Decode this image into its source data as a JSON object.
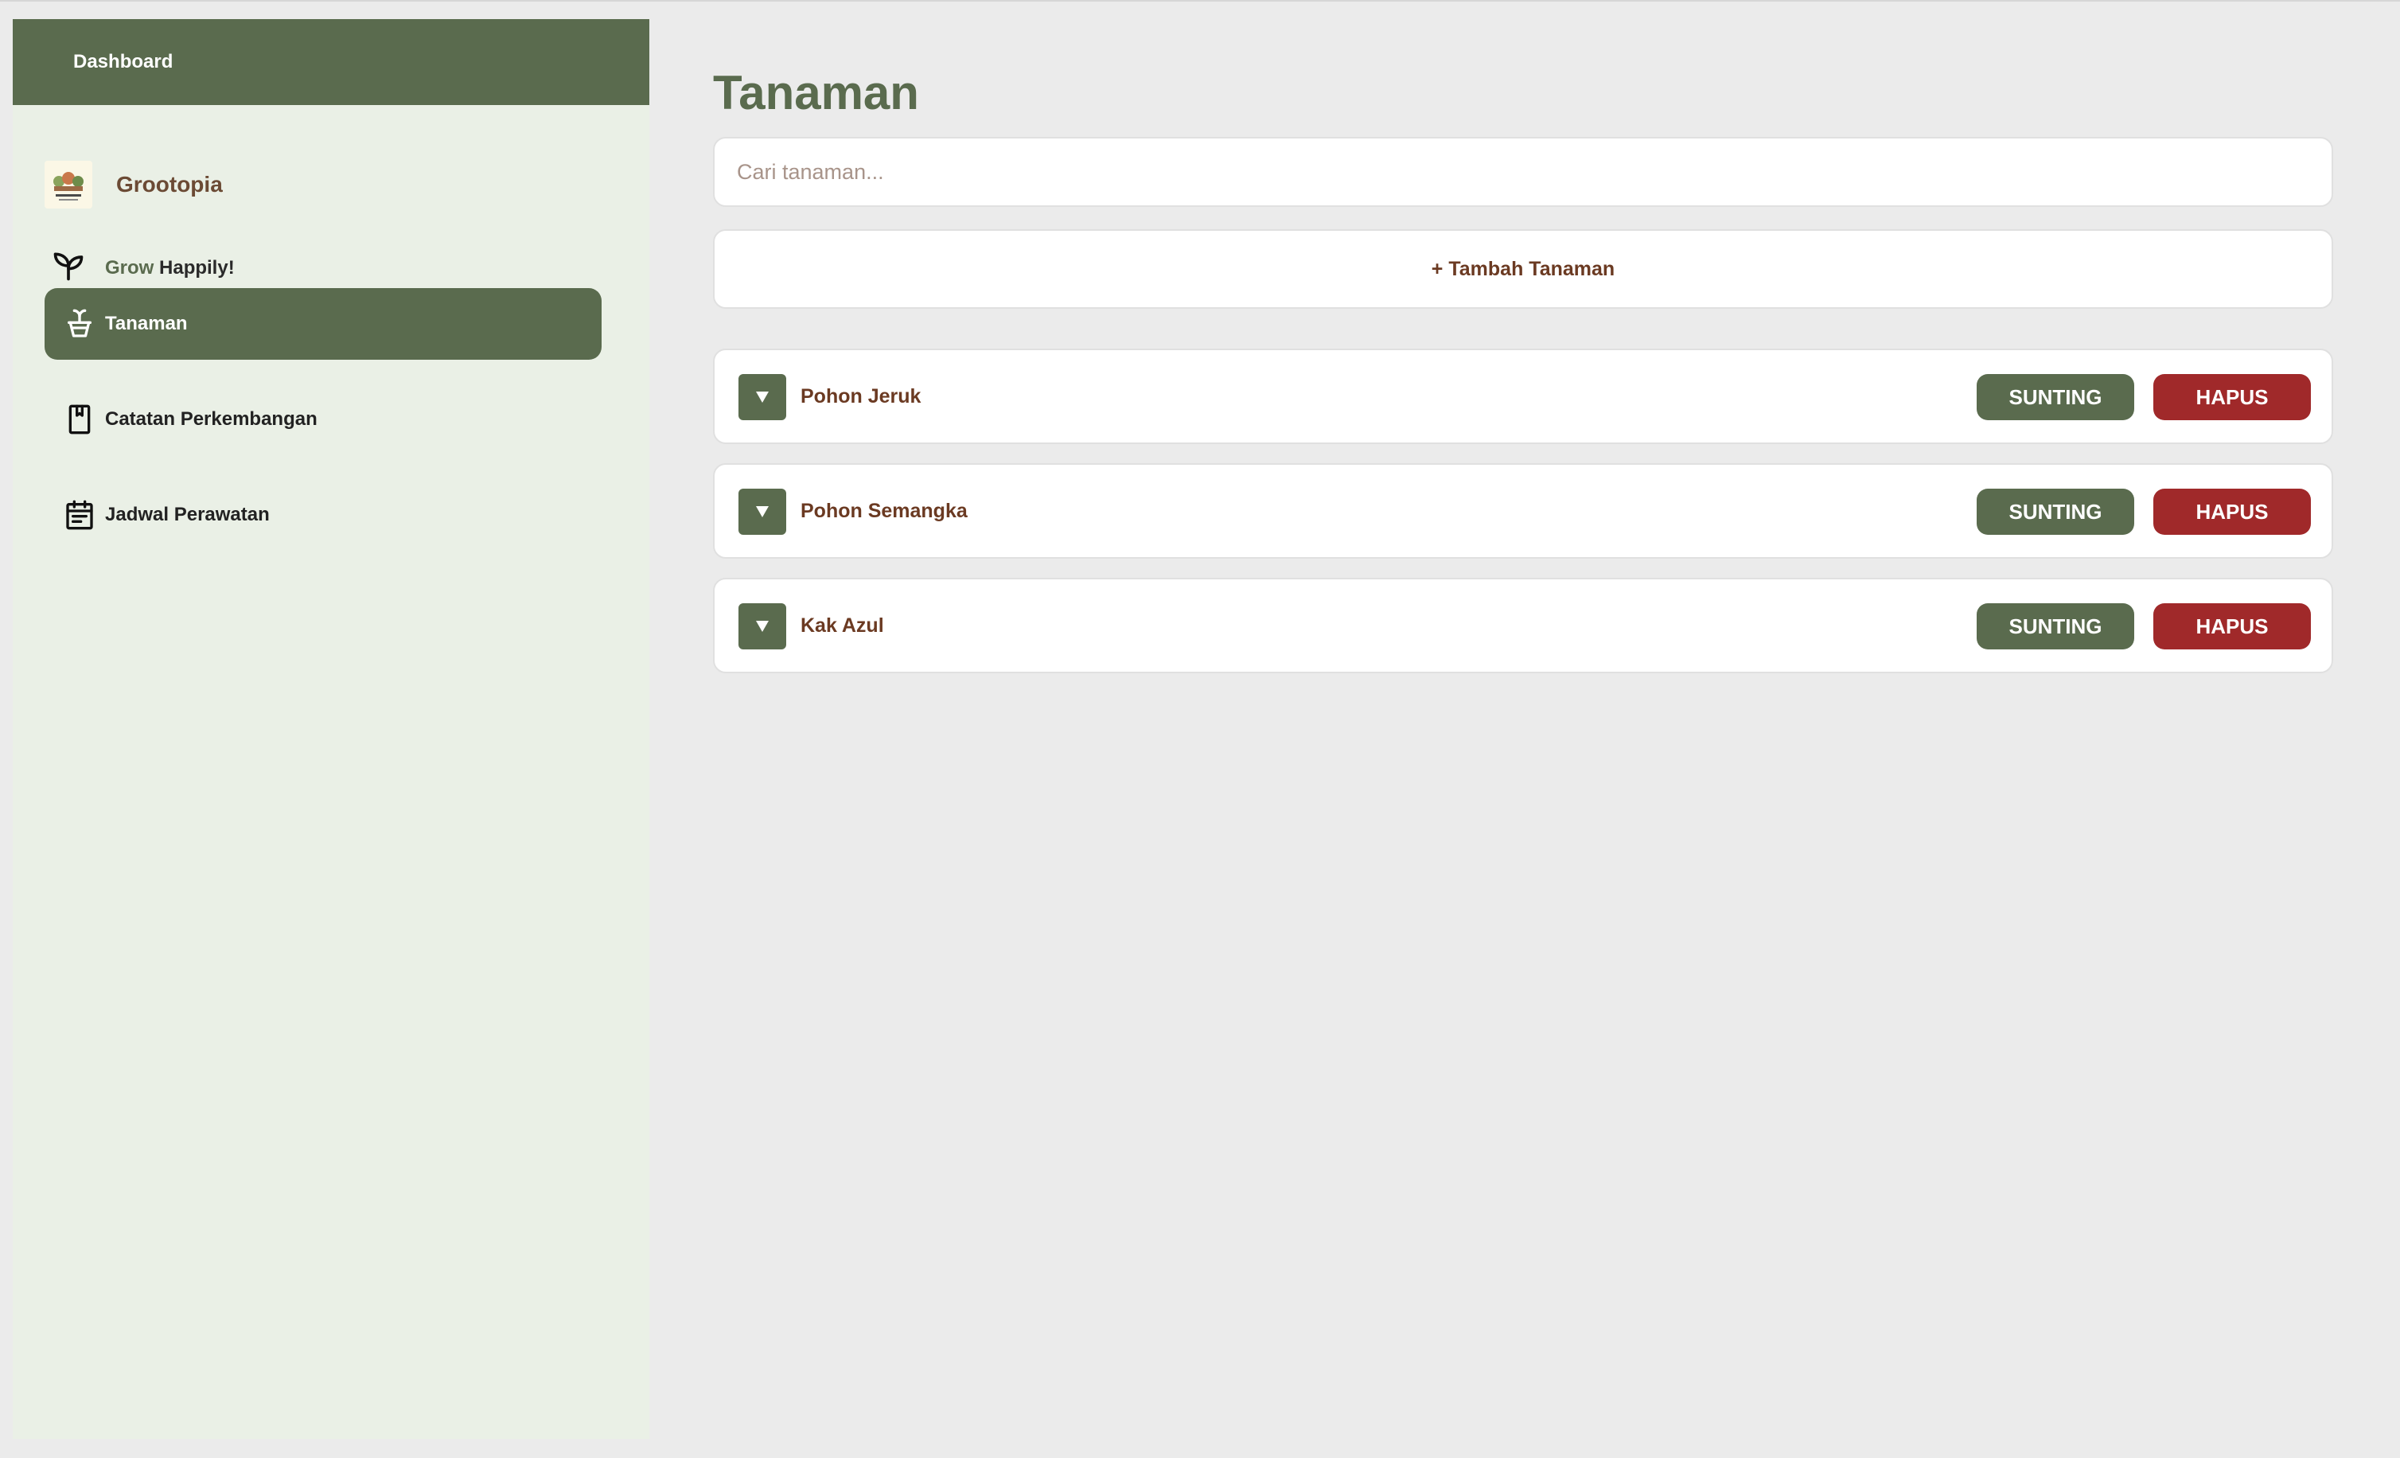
{
  "sidebar": {
    "header_label": "Dashboard",
    "brand_name": "Grootopia",
    "tagline_grow": "Grow",
    "tagline_rest": "Happily!",
    "items": [
      {
        "label": "Tanaman",
        "icon": "plant-pot-icon",
        "active": true
      },
      {
        "label": "Catatan Perkembangan",
        "icon": "notebook-icon",
        "active": false
      },
      {
        "label": "Jadwal Perawatan",
        "icon": "calendar-icon",
        "active": false
      }
    ]
  },
  "main": {
    "title": "Tanaman",
    "search_placeholder": "Cari tanaman...",
    "add_label": "+ Tambah Tanaman",
    "edit_label": "SUNTING",
    "delete_label": "HAPUS",
    "plants": [
      {
        "name": "Pohon Jeruk"
      },
      {
        "name": "Pohon Semangka"
      },
      {
        "name": "Kak Azul"
      }
    ]
  },
  "colors": {
    "accent": "#5a6b4e",
    "danger": "#a0292a",
    "brown_text": "#6b3a22",
    "sidebar_bg": "#eaf0e6",
    "page_bg": "#ebebeb"
  }
}
